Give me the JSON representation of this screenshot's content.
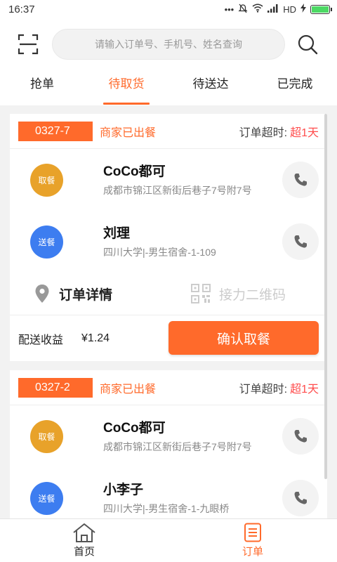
{
  "status_bar": {
    "time": "16:37",
    "dots": "•••",
    "network": "HD"
  },
  "header": {
    "search_placeholder": "请输入订单号、手机号、姓名查询"
  },
  "tabs": [
    {
      "label": "抢单",
      "active": false
    },
    {
      "label": "待取货",
      "active": true
    },
    {
      "label": "待送达",
      "active": false
    },
    {
      "label": "已完成",
      "active": false
    }
  ],
  "orders": [
    {
      "order_no": "0327-7",
      "status": "商家已出餐",
      "timeout_label": "订单超时:",
      "timeout_value": "超1天",
      "pickup": {
        "badge": "取餐",
        "name": "CoCo都可",
        "address": "成都市锦江区新街后巷子7号附7号"
      },
      "delivery": {
        "badge": "送餐",
        "name": "刘理",
        "address": "四川大学|-男生宿舍-1-109"
      },
      "detail_label": "订单详情",
      "qr_label": "接力二维码",
      "earning_label": "配送收益",
      "earning_value": "¥1.24",
      "confirm_label": "确认取餐"
    },
    {
      "order_no": "0327-2",
      "status": "商家已出餐",
      "timeout_label": "订单超时:",
      "timeout_value": "超1天",
      "pickup": {
        "badge": "取餐",
        "name": "CoCo都可",
        "address": "成都市锦江区新街后巷子7号附7号"
      },
      "delivery": {
        "badge": "送餐",
        "name": "小李子",
        "address": "四川大学|-男生宿舍-1-九眼桥"
      }
    }
  ],
  "bottom_nav": [
    {
      "label": "首页",
      "icon": "home-icon",
      "active": false
    },
    {
      "label": "订单",
      "icon": "orders-icon",
      "active": true
    }
  ],
  "colors": {
    "accent": "#ff6a2b",
    "pickup_badge": "#e8a22a",
    "delivery_badge": "#3d7df0",
    "timeout": "#ff4b4b"
  }
}
